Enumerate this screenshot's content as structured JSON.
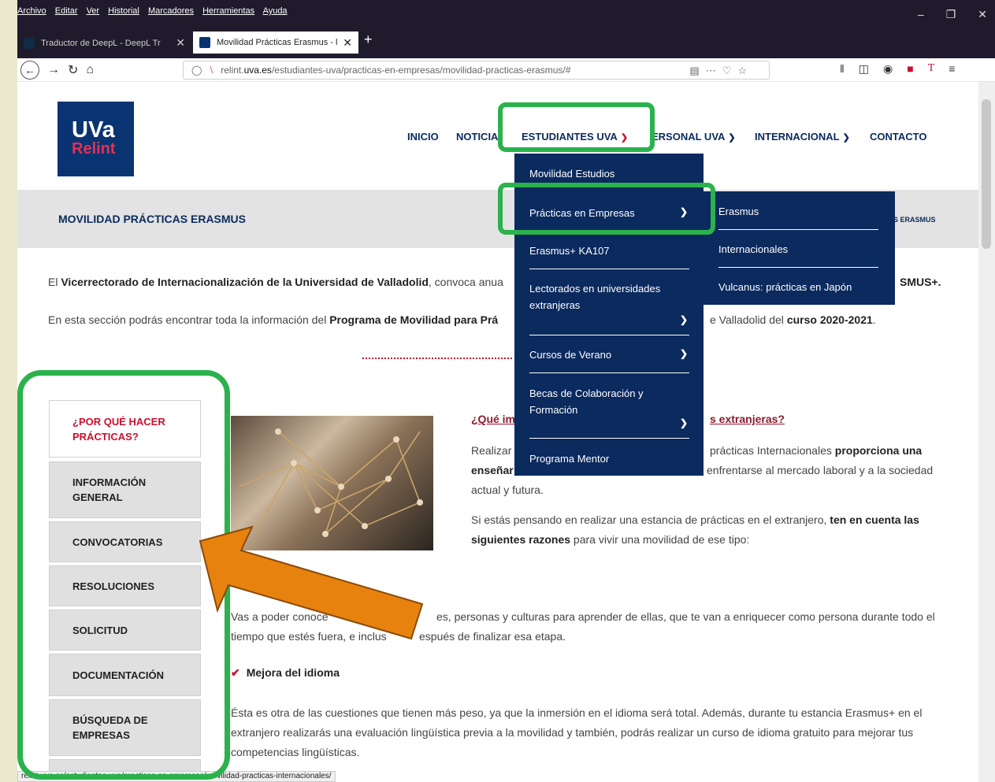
{
  "browser": {
    "menu": [
      "Archivo",
      "Editar",
      "Ver",
      "Historial",
      "Marcadores",
      "Herramientas",
      "Ayuda"
    ],
    "tabs": [
      {
        "title": "Traductor de DeepL - DeepL Tr"
      },
      {
        "title": "Movilidad Prácticas Erasmus - l"
      }
    ],
    "url_pre": "relint.",
    "url_domain": "uva.es",
    "url_post": "/estudiantes-uva/practicas-en-empresas/movilidad-practicas-erasmus/#",
    "status_url": "relint.uva.es/estudiantes-uva/practicas-en-empresas/movilidad-practicas-internacionales/"
  },
  "logo": {
    "line1": "UVa",
    "line2": "Relint"
  },
  "nav": {
    "inicio": "INICIO",
    "noticias": "NOTICIA",
    "estudiantes": "ESTUDIANTES UVA",
    "personal": "ERSONAL UVA",
    "internacional": "INTERNACIONAL",
    "contacto": "CONTACTO"
  },
  "page_title": "MOVILIDAD PRÁCTICAS ERASMUS",
  "breadcrumb_tail": "S ERASMUS",
  "intro": {
    "p1_a": "El ",
    "p1_b": "Vicerrectorado de Internacionalización de la Universidad de Valladolid",
    "p1_c": ", convoca anua",
    "p1_end": "SMUS+.",
    "p2_a": "En esta sección podrás encontrar toda la información del ",
    "p2_b": "Programa de Movilidad para Prá",
    "p2_c": "e Valladolid del ",
    "p2_d": "curso 2020-2021",
    "p2_e": "."
  },
  "sidebar": [
    {
      "label1": "¿POR QUÉ HACER",
      "label2": "PRÁCTICAS?"
    },
    {
      "label1": "INFORMACIÓN",
      "label2": "GENERAL"
    },
    {
      "label1": "CONVOCATORIAS",
      "label2": ""
    },
    {
      "label1": "RESOLUCIONES",
      "label2": ""
    },
    {
      "label1": "SOLICITUD",
      "label2": ""
    },
    {
      "label1": "DOCUMENTACIÓN",
      "label2": ""
    },
    {
      "label1": "BÚSQUEDA DE",
      "label2": "EMPRESAS"
    }
  ],
  "content": {
    "q_a": "¿Qué im",
    "q_b": "s extranjeras?",
    "l1_a": "Realizar",
    "l1_b": "prácticas Internacionales ",
    "l1_c": "proporciona una",
    "l2_a": "enseñar",
    "l2_b": "enfrentarse al mercado laboral y a la sociedad",
    "l3": "actual y futura.",
    "l4_a": "Si estás pensando en realizar una estancia de prácticas en el extranjero, ",
    "l4_b": "ten en cuenta las",
    "l5_a": "siguientes razones",
    "l5_b": " para vivir una movilidad de ese tipo:",
    "l6_a": "Vas a poder conoce",
    "l6_b": "es, personas y culturas para aprender de ellas, que te van a enriquecer como persona durante todo el",
    "l7_a": "tiempo que estés fuera, e inclus",
    "l7_b": "espués de finalizar esa etapa.",
    "check": "Mejora del idioma",
    "l8": "Ésta es otra de las cuestiones que tienen más peso, ya que la inmersión en el idioma será total. Además, durante tu estancia Erasmus+ en el",
    "l9": "extranjero realizarás una evaluación lingüística previa a la movilidad y también, podrás realizar un curso de idioma gratuito para mejorar tus",
    "l10": "competencias lingüísticas."
  },
  "dropdown": {
    "items": [
      {
        "l1": "Movilidad Estudios",
        "l2": ""
      },
      {
        "l1": "Prácticas en Empresas",
        "l2": ""
      },
      {
        "l1": "Erasmus+ KA107",
        "l2": ""
      },
      {
        "l1": "Lectorados en universidades",
        "l2": "extranjeras"
      },
      {
        "l1": "Cursos de Verano",
        "l2": ""
      },
      {
        "l1": "Becas de Colaboración y",
        "l2": "Formación"
      },
      {
        "l1": "Programa Mentor",
        "l2": ""
      }
    ],
    "submenu": [
      "Erasmus",
      "Internacionales",
      "Vulcanus: prácticas en Japón"
    ]
  },
  "colors": {
    "navy": "#0b2a5e",
    "crimson": "#c8102e",
    "highlight": "#2bb24c",
    "arrow": "#e8820f"
  }
}
